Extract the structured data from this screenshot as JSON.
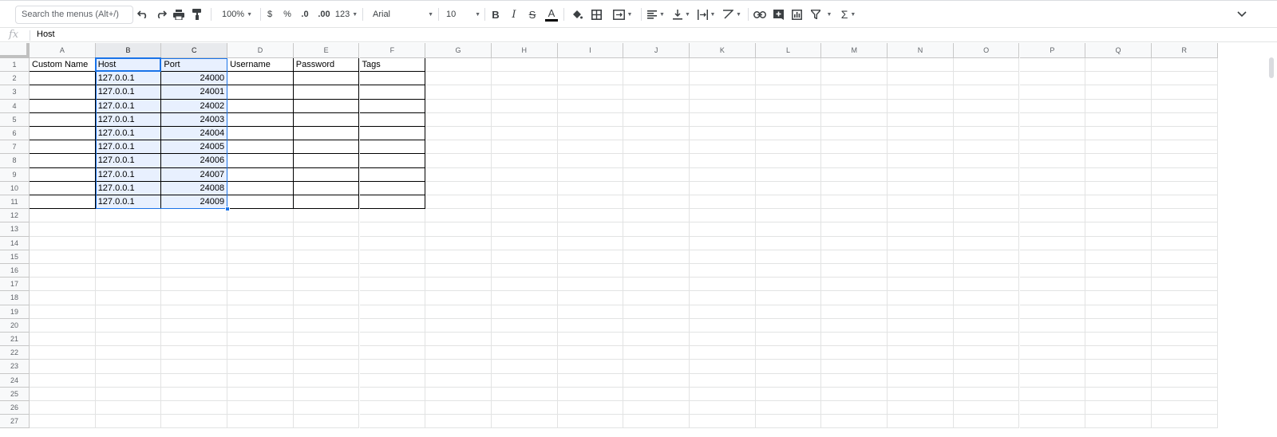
{
  "toolbar": {
    "search_placeholder": "Search the menus (Alt+/)",
    "zoom": "100%",
    "currency": "$",
    "percent": "%",
    "decimal_decrease": ".0",
    "decimal_increase": ".00",
    "number_format": "123",
    "font": "Arial",
    "font_size": "10",
    "bold": "B",
    "italic": "I",
    "strike": "S",
    "text_color": "A",
    "sum": "Σ",
    "icons": [
      "undo-icon",
      "redo-icon",
      "print-icon",
      "paint-format-icon",
      "fill-color-icon",
      "borders-icon",
      "merge-icon",
      "align-icon",
      "valign-icon",
      "wrap-icon",
      "rotate-icon",
      "link-icon",
      "comment-icon",
      "chart-icon",
      "filter-icon",
      "functions-icon",
      "collapse-icon"
    ]
  },
  "formula_bar": {
    "fx": "fx",
    "value": "Host"
  },
  "columns": [
    "A",
    "B",
    "C",
    "D",
    "E",
    "F",
    "G",
    "H",
    "I",
    "J",
    "K",
    "L",
    "M",
    "N",
    "O",
    "P",
    "Q",
    "R"
  ],
  "rows": [
    "1",
    "2",
    "3",
    "4",
    "5",
    "6",
    "7",
    "8",
    "9",
    "10",
    "11",
    "12",
    "13",
    "14",
    "15",
    "16",
    "17",
    "18",
    "19",
    "20",
    "21",
    "22",
    "23",
    "24",
    "25",
    "26",
    "27"
  ],
  "sheet": {
    "headers": [
      "Custom Name",
      "Host",
      "Port",
      "Username",
      "Password",
      "Tags"
    ],
    "data": [
      [
        "",
        "127.0.0.1",
        "24000",
        "",
        "",
        ""
      ],
      [
        "",
        "127.0.0.1",
        "24001",
        "",
        "",
        ""
      ],
      [
        "",
        "127.0.0.1",
        "24002",
        "",
        "",
        ""
      ],
      [
        "",
        "127.0.0.1",
        "24003",
        "",
        "",
        ""
      ],
      [
        "",
        "127.0.0.1",
        "24004",
        "",
        "",
        ""
      ],
      [
        "",
        "127.0.0.1",
        "24005",
        "",
        "",
        ""
      ],
      [
        "",
        "127.0.0.1",
        "24006",
        "",
        "",
        ""
      ],
      [
        "",
        "127.0.0.1",
        "24007",
        "",
        "",
        ""
      ],
      [
        "",
        "127.0.0.1",
        "24008",
        "",
        "",
        ""
      ],
      [
        "",
        "127.0.0.1",
        "24009",
        "",
        "",
        ""
      ]
    ]
  },
  "colors": {
    "selection": "#1a73e8",
    "selection_fill": "#e8f0fe"
  }
}
